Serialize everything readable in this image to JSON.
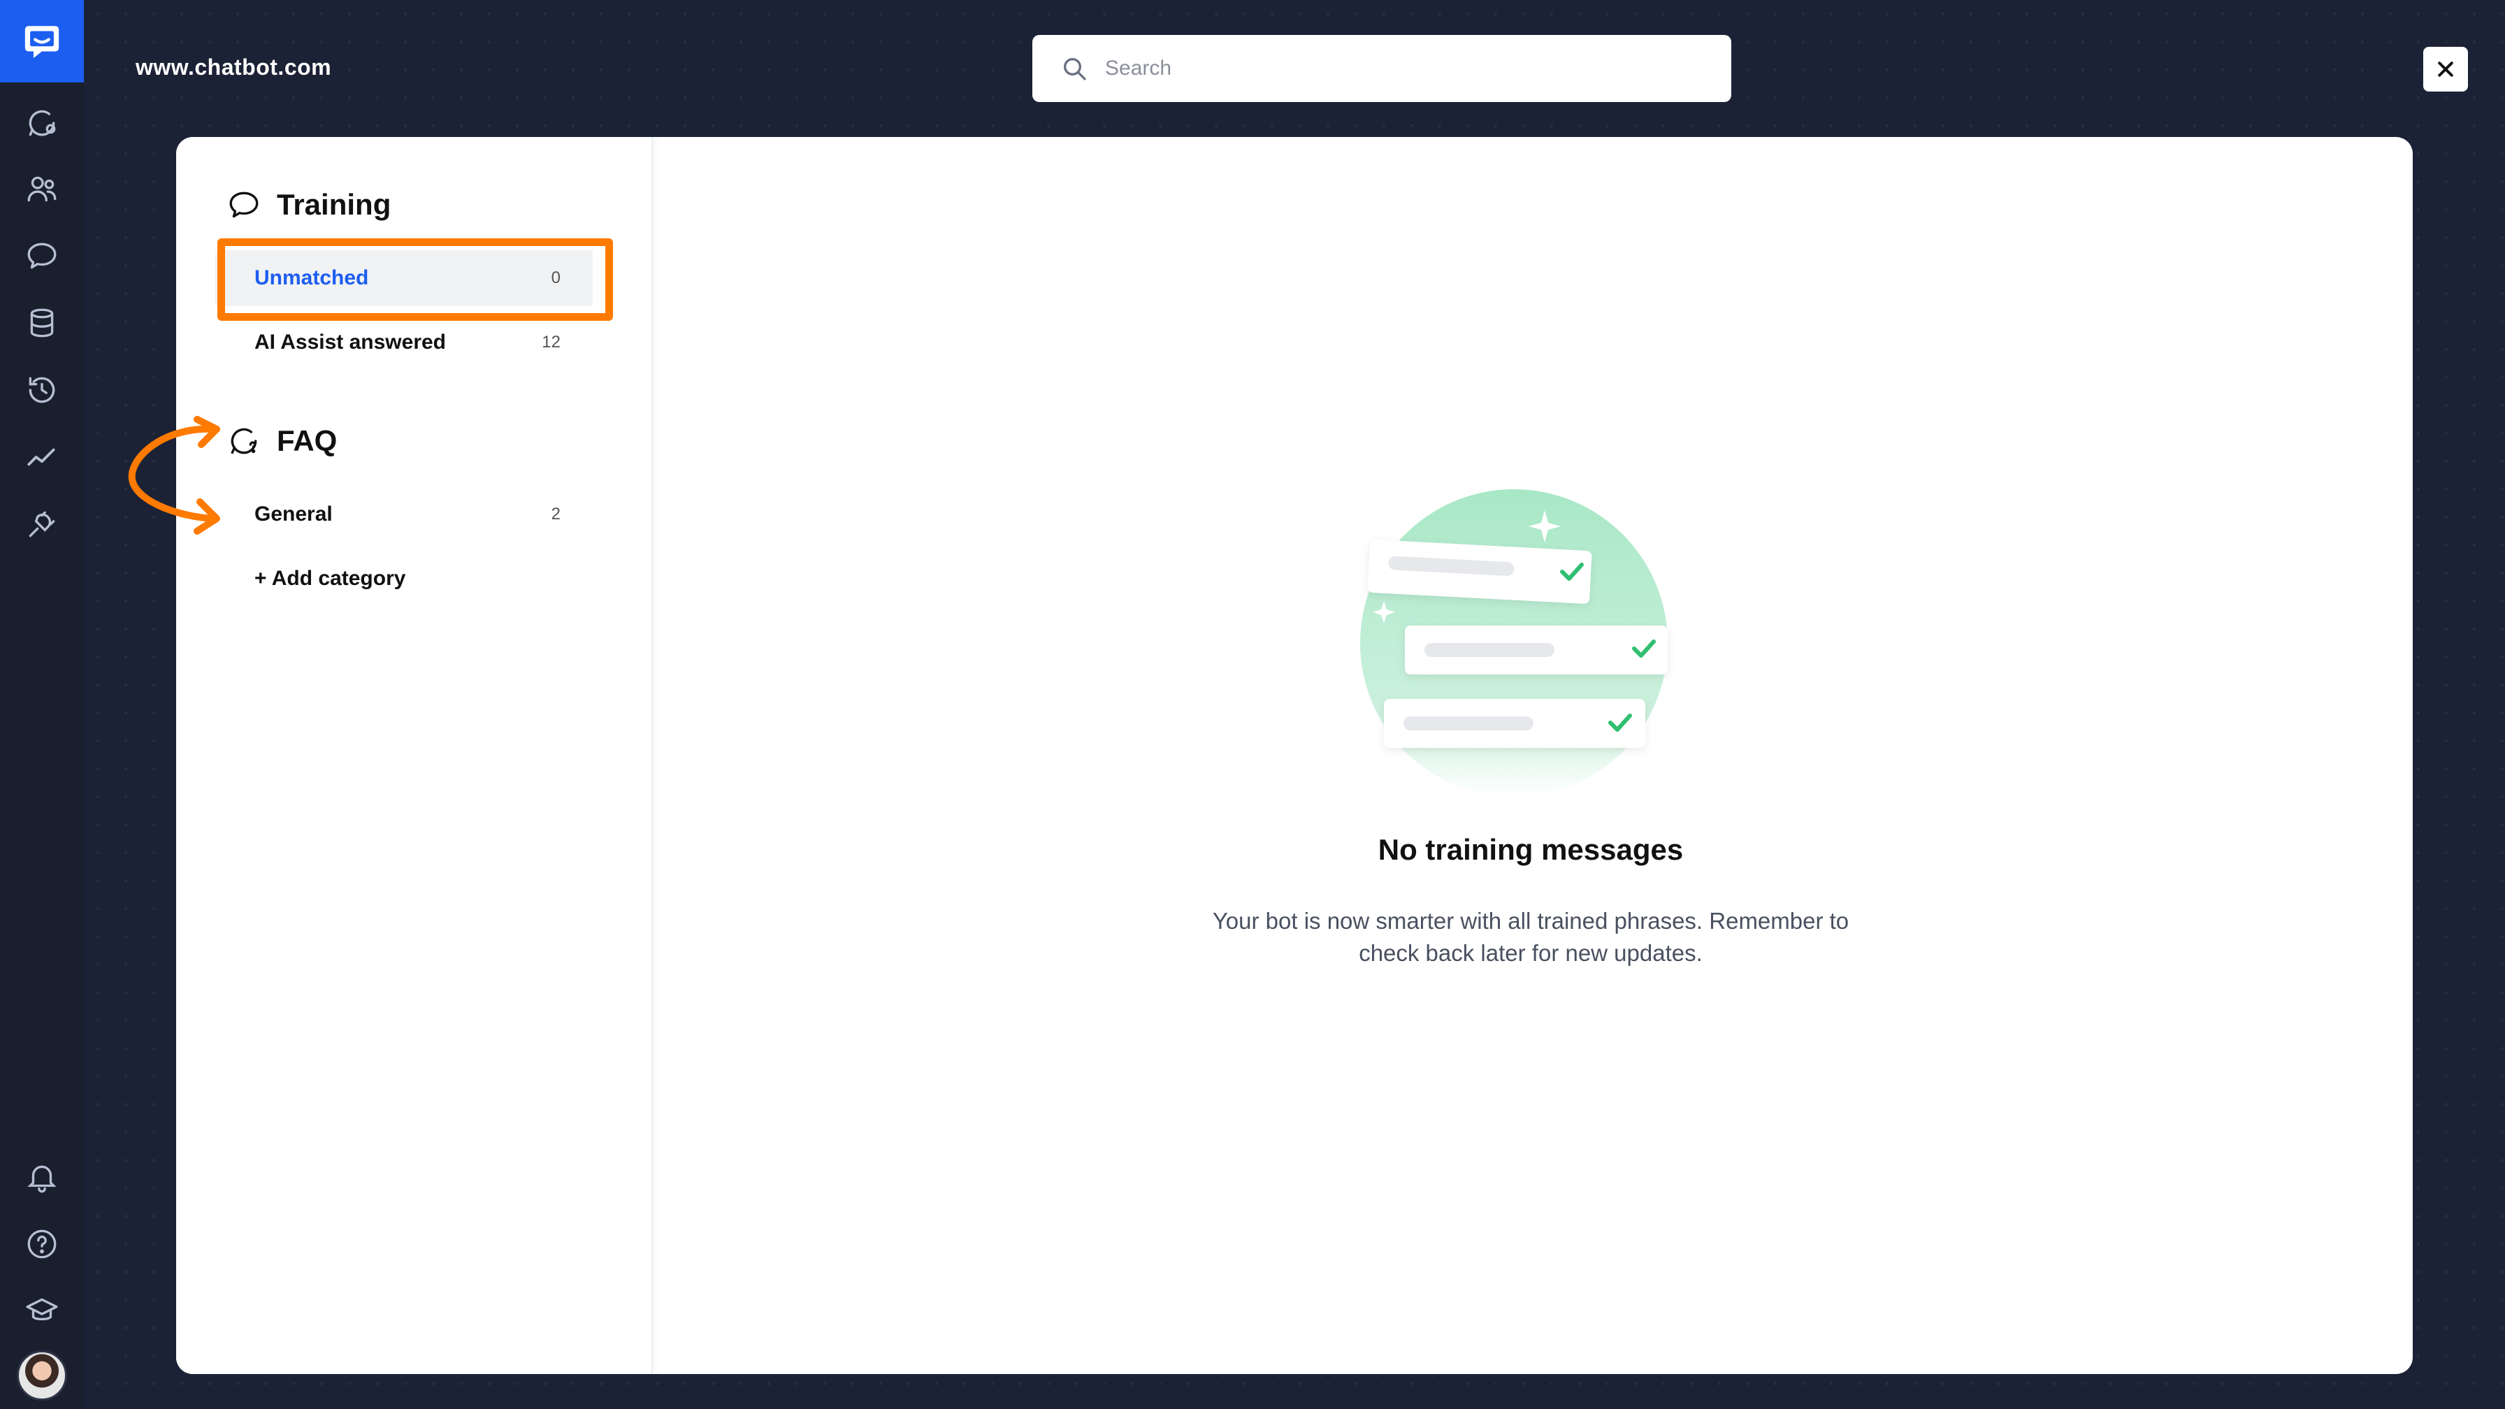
{
  "header": {
    "site_title": "www.chatbot.com",
    "search_placeholder": "Search"
  },
  "rail": {
    "items": [
      "chats-icon",
      "users-icon",
      "bot-training-icon",
      "database-icon",
      "history-icon",
      "analytics-icon",
      "integrations-icon"
    ],
    "bottom_items": [
      "notifications-icon",
      "help-icon",
      "academy-icon",
      "avatar"
    ]
  },
  "sidebar": {
    "training": {
      "title": "Training",
      "items": [
        {
          "label": "Unmatched",
          "count": "0",
          "active": true
        },
        {
          "label": "AI Assist answered",
          "count": "12",
          "active": false
        }
      ]
    },
    "faq": {
      "title": "FAQ",
      "items": [
        {
          "label": "General",
          "count": "2"
        }
      ],
      "add_label": "+ Add category"
    }
  },
  "empty_state": {
    "title": "No training messages",
    "line1": "Your bot is now smarter with all trained phrases. Remember to",
    "line2": "check back later for new updates."
  },
  "colors": {
    "background": "#1c2236",
    "accent": "#1c5ef0",
    "highlight": "#ff7a00",
    "success": "#2fbf71"
  }
}
